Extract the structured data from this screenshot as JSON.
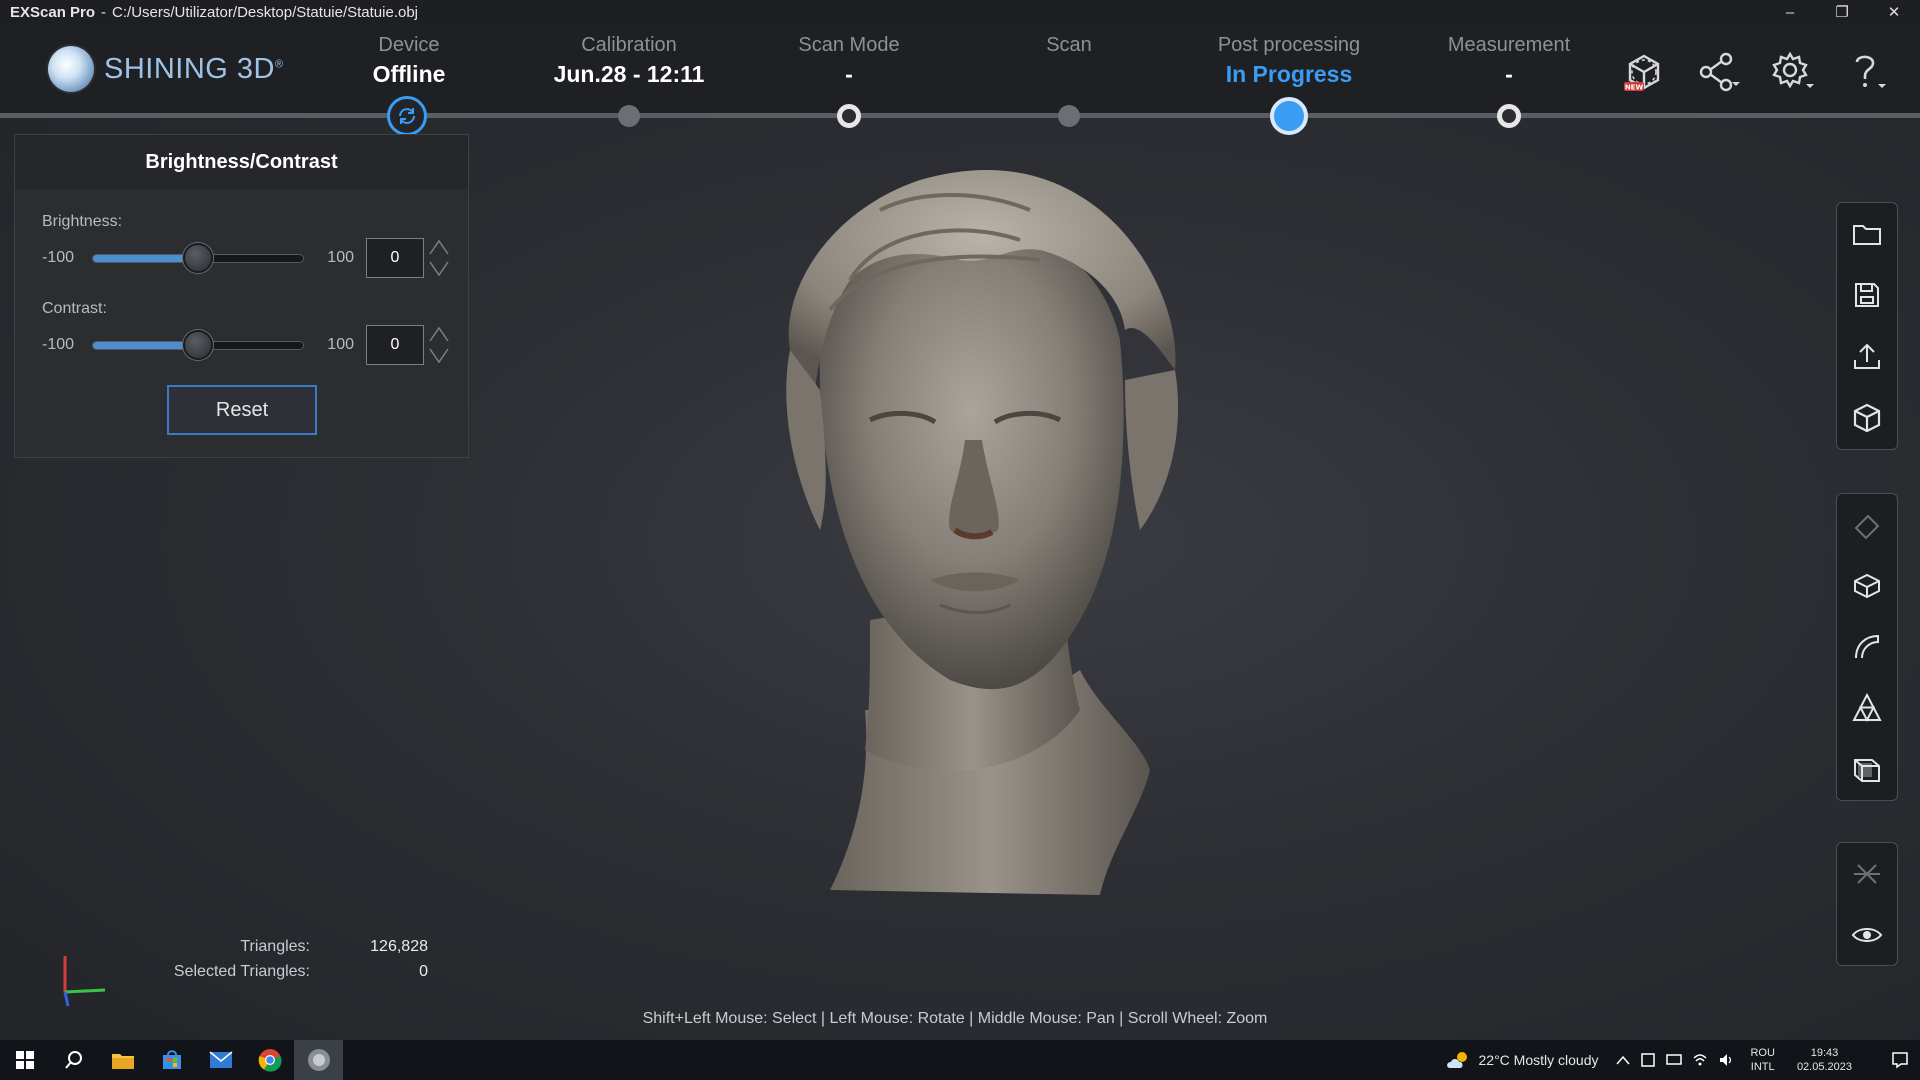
{
  "titlebar": {
    "app": "EXScan Pro",
    "separator": "-",
    "path": "C:/Users/Utilizator/Desktop/Statuie/Statuie.obj",
    "minimize": "–",
    "restore": "❐",
    "close": "✕"
  },
  "logo": {
    "text": "SHINING 3D",
    "mark": "®"
  },
  "steps": [
    {
      "label": "Device",
      "value": "Offline"
    },
    {
      "label": "Calibration",
      "value": "Jun.28 - 12:11"
    },
    {
      "label": "Scan Mode",
      "value": "-"
    },
    {
      "label": "Scan",
      "value": ""
    },
    {
      "label": "Post processing",
      "value": "In Progress"
    },
    {
      "label": "Measurement",
      "value": "-"
    }
  ],
  "header_icons": [
    "model-store-icon",
    "share-icon",
    "settings-icon",
    "help-icon"
  ],
  "header_badge": "NEW",
  "panel": {
    "title": "Brightness/Contrast",
    "brightness": {
      "label": "Brightness:",
      "min": "-100",
      "max": "100",
      "value": "0",
      "level": 0.5
    },
    "contrast": {
      "label": "Contrast:",
      "min": "-100",
      "max": "100",
      "value": "0",
      "level": 0.5
    },
    "reset": "Reset"
  },
  "toolbar_groups": [
    [
      "open-folder-icon",
      "save-icon",
      "export-icon",
      "model-cube-icon"
    ],
    [
      "eraser-icon",
      "cut-plane-icon",
      "curve-icon",
      "triangle-mesh-icon",
      "box-icon"
    ],
    [
      "flip-icon",
      "visibility-eye-icon"
    ]
  ],
  "stats": {
    "triangles_label": "Triangles:",
    "triangles_value": "126,828",
    "selected_label": "Selected Triangles:",
    "selected_value": "0"
  },
  "hint": "Shift+Left Mouse: Select | Left Mouse: Rotate | Middle Mouse: Pan | Scroll Wheel: Zoom",
  "taskbar": {
    "weather": "22°C  Mostly cloudy",
    "lang1": "ROU",
    "lang2": "INTL",
    "time": "19:43",
    "date": "02.05.2023"
  },
  "colors": {
    "accent": "#3a9cf2",
    "background": "#2c2e33"
  }
}
